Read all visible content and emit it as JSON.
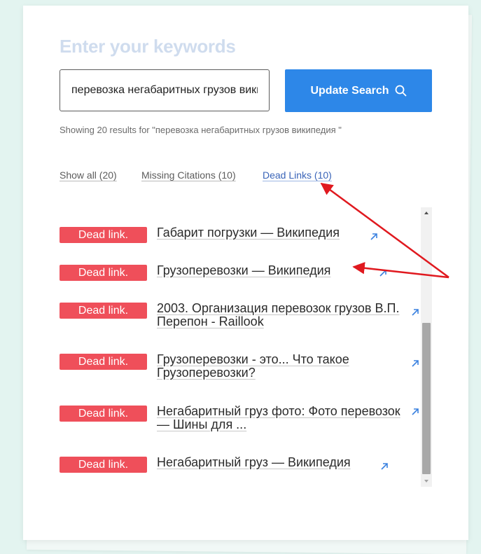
{
  "heading": "Enter your keywords",
  "search": {
    "value": "перевозка негабаритных грузов википедия"
  },
  "update_button": {
    "label": "Update Search",
    "icon": "search-icon"
  },
  "results_info": "Showing 20 results for \"перевозка негабаритных грузов википедия \"",
  "filters": [
    {
      "label": "Show all (20)",
      "active": false
    },
    {
      "label": "Missing Citations (10)",
      "active": false
    },
    {
      "label": "Dead Links (10)",
      "active": true
    }
  ],
  "results": [
    {
      "badge": "Dead link.",
      "title": "Габарит погрузки — Википедия"
    },
    {
      "badge": "Dead link.",
      "title": "Грузоперевозки — Википедия"
    },
    {
      "badge": "Dead link.",
      "title": "2003. Организация перевозок грузов В.П. Перепон - Raillook"
    },
    {
      "badge": "Dead link.",
      "title": "Грузоперевозки - это... Что такое Грузоперевозки?"
    },
    {
      "badge": "Dead link.",
      "title": "Негабаритный груз фото: Фото перевозок — Шины для ..."
    },
    {
      "badge": "Dead link.",
      "title": "Негабаритный груз — Википедия"
    }
  ],
  "colors": {
    "badge": "#ef4f5a",
    "button": "#2d87e8",
    "active_filter": "#3a64b8",
    "annotation_arrow": "#e0191f",
    "external_icon": "#3b82e0"
  }
}
